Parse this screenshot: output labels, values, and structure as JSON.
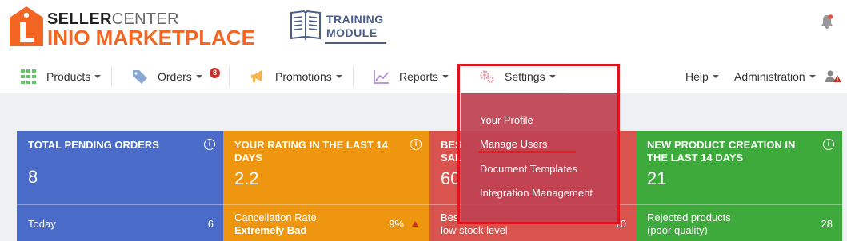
{
  "header": {
    "logo_top_bold": "SELLER",
    "logo_top_light": "CENTER",
    "logo_main": "INIO MARKETPLACE",
    "logo_letter": "L",
    "training_line1": "TRAINING",
    "training_line2": "MODULE"
  },
  "nav": {
    "products": "Products",
    "orders": "Orders",
    "orders_badge": "8",
    "promotions": "Promotions",
    "reports": "Reports",
    "settings": "Settings",
    "help": "Help",
    "administration": "Administration"
  },
  "settings_menu": {
    "items": [
      "Your Profile",
      "Manage Users",
      "Document Templates",
      "Integration Management"
    ]
  },
  "cards": [
    {
      "title": "TOTAL PENDING ORDERS",
      "value": "8",
      "foot_label": "Today",
      "foot_value": "6",
      "color": "#4a6bc7"
    },
    {
      "title": "YOUR RATING IN THE LAST 14 DAYS",
      "value": "2.2",
      "foot_label": "Cancellation Rate",
      "foot_label2": "Extremely Bad",
      "foot_value": "9%",
      "color": "#ee960f"
    },
    {
      "title_part1": "BES",
      "title_part2": "SAL",
      "value": "60",
      "foot_label": "Bes",
      "foot_label2": "low stock level",
      "foot_value": "10",
      "color": "#d9534f"
    },
    {
      "title": "NEW PRODUCT CREATION IN THE LAST 14 DAYS",
      "value": "21",
      "foot_label": "Rejected products",
      "foot_label2": "(poor quality)",
      "foot_value": "28",
      "color": "#3eaa3b"
    }
  ],
  "colors": {
    "brand_orange": "#f26522",
    "highlight_red": "#e0141e",
    "dropdown_bg": "#c04252"
  }
}
